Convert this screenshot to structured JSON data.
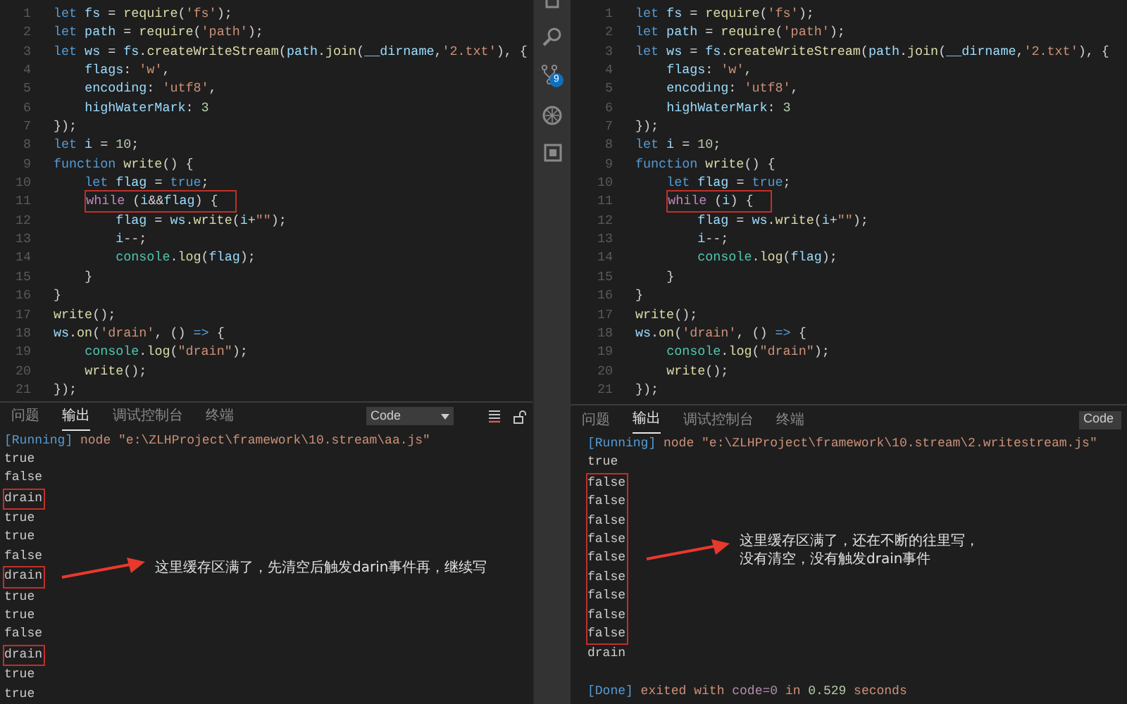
{
  "activity_bar": {
    "badge": "9"
  },
  "panes": [
    {
      "code": [
        {
          "number": "1",
          "boxed": false,
          "tokens": [
            {
              "kind": "kw",
              "text": "let"
            },
            {
              "kind": "var",
              "text": " fs"
            },
            {
              "kind": "plain",
              "text": " = "
            },
            {
              "kind": "fn",
              "text": "require"
            },
            {
              "kind": "plain",
              "text": "("
            },
            {
              "kind": "str",
              "text": "'fs'"
            },
            {
              "kind": "plain",
              "text": ");"
            }
          ]
        },
        {
          "number": "2",
          "boxed": false,
          "tokens": [
            {
              "kind": "kw",
              "text": "let"
            },
            {
              "kind": "var",
              "text": " path"
            },
            {
              "kind": "plain",
              "text": " = "
            },
            {
              "kind": "fn",
              "text": "require"
            },
            {
              "kind": "plain",
              "text": "("
            },
            {
              "kind": "str",
              "text": "'path'"
            },
            {
              "kind": "plain",
              "text": ");"
            }
          ]
        },
        {
          "number": "3",
          "boxed": false,
          "tokens": [
            {
              "kind": "kw",
              "text": "let"
            },
            {
              "kind": "var",
              "text": " ws"
            },
            {
              "kind": "plain",
              "text": " = "
            },
            {
              "kind": "var",
              "text": "fs"
            },
            {
              "kind": "plain",
              "text": "."
            },
            {
              "kind": "fn",
              "text": "createWriteStream"
            },
            {
              "kind": "plain",
              "text": "("
            },
            {
              "kind": "var",
              "text": "path"
            },
            {
              "kind": "plain",
              "text": "."
            },
            {
              "kind": "fn",
              "text": "join"
            },
            {
              "kind": "plain",
              "text": "("
            },
            {
              "kind": "var",
              "text": "__dirname"
            },
            {
              "kind": "plain",
              "text": ","
            },
            {
              "kind": "str",
              "text": "'2.txt'"
            },
            {
              "kind": "plain",
              "text": "), {"
            }
          ]
        },
        {
          "number": "4",
          "boxed": false,
          "tokens": [
            {
              "kind": "var",
              "text": "    flags"
            },
            {
              "kind": "plain",
              "text": ": "
            },
            {
              "kind": "str",
              "text": "'w'"
            },
            {
              "kind": "plain",
              "text": ","
            }
          ]
        },
        {
          "number": "5",
          "boxed": false,
          "tokens": [
            {
              "kind": "var",
              "text": "    encoding"
            },
            {
              "kind": "plain",
              "text": ": "
            },
            {
              "kind": "str",
              "text": "'utf8'"
            },
            {
              "kind": "plain",
              "text": ","
            }
          ]
        },
        {
          "number": "6",
          "boxed": false,
          "tokens": [
            {
              "kind": "var",
              "text": "    highWaterMark"
            },
            {
              "kind": "plain",
              "text": ": "
            },
            {
              "kind": "num",
              "text": "3"
            }
          ]
        },
        {
          "number": "7",
          "boxed": false,
          "tokens": [
            {
              "kind": "plain",
              "text": "});"
            }
          ]
        },
        {
          "number": "8",
          "boxed": false,
          "tokens": [
            {
              "kind": "kw",
              "text": "let"
            },
            {
              "kind": "var",
              "text": " i"
            },
            {
              "kind": "plain",
              "text": " = "
            },
            {
              "kind": "num",
              "text": "10"
            },
            {
              "kind": "plain",
              "text": ";"
            }
          ]
        },
        {
          "number": "9",
          "boxed": false,
          "tokens": [
            {
              "kind": "kw",
              "text": "function"
            },
            {
              "kind": "fn",
              "text": " write"
            },
            {
              "kind": "plain",
              "text": "() {"
            }
          ]
        },
        {
          "number": "10",
          "boxed": false,
          "tokens": [
            {
              "kind": "kw",
              "text": "    let"
            },
            {
              "kind": "var",
              "text": " flag"
            },
            {
              "kind": "plain",
              "text": " = "
            },
            {
              "kind": "kw",
              "text": "true"
            },
            {
              "kind": "plain",
              "text": ";"
            }
          ]
        },
        {
          "number": "11",
          "boxed": true,
          "tokens": [
            {
              "kind": "ctrl",
              "text": "    while"
            },
            {
              "kind": "plain",
              "text": " ("
            },
            {
              "kind": "var",
              "text": "i"
            },
            {
              "kind": "plain",
              "text": "&&"
            },
            {
              "kind": "var",
              "text": "flag"
            },
            {
              "kind": "plain",
              "text": ") {"
            }
          ]
        },
        {
          "number": "12",
          "boxed": false,
          "tokens": [
            {
              "kind": "var",
              "text": "        flag"
            },
            {
              "kind": "plain",
              "text": " = "
            },
            {
              "kind": "var",
              "text": "ws"
            },
            {
              "kind": "plain",
              "text": "."
            },
            {
              "kind": "fn",
              "text": "write"
            },
            {
              "kind": "plain",
              "text": "("
            },
            {
              "kind": "var",
              "text": "i"
            },
            {
              "kind": "plain",
              "text": "+"
            },
            {
              "kind": "str",
              "text": "\"\""
            },
            {
              "kind": "plain",
              "text": ");"
            }
          ]
        },
        {
          "number": "13",
          "boxed": false,
          "tokens": [
            {
              "kind": "var",
              "text": "        i"
            },
            {
              "kind": "plain",
              "text": "--;"
            }
          ]
        },
        {
          "number": "14",
          "boxed": false,
          "tokens": [
            {
              "kind": "type",
              "text": "        console"
            },
            {
              "kind": "plain",
              "text": "."
            },
            {
              "kind": "fn",
              "text": "log"
            },
            {
              "kind": "plain",
              "text": "("
            },
            {
              "kind": "var",
              "text": "flag"
            },
            {
              "kind": "plain",
              "text": ");"
            }
          ]
        },
        {
          "number": "15",
          "boxed": false,
          "tokens": [
            {
              "kind": "plain",
              "text": "    }"
            }
          ]
        },
        {
          "number": "16",
          "boxed": false,
          "tokens": [
            {
              "kind": "plain",
              "text": "}"
            }
          ]
        },
        {
          "number": "17",
          "boxed": false,
          "tokens": [
            {
              "kind": "fn",
              "text": "write"
            },
            {
              "kind": "plain",
              "text": "();"
            }
          ]
        },
        {
          "number": "18",
          "boxed": false,
          "tokens": [
            {
              "kind": "var",
              "text": "ws"
            },
            {
              "kind": "plain",
              "text": "."
            },
            {
              "kind": "fn",
              "text": "on"
            },
            {
              "kind": "plain",
              "text": "("
            },
            {
              "kind": "str",
              "text": "'drain'"
            },
            {
              "kind": "plain",
              "text": ", () "
            },
            {
              "kind": "kw",
              "text": "=>"
            },
            {
              "kind": "plain",
              "text": " {"
            }
          ]
        },
        {
          "number": "19",
          "boxed": false,
          "tokens": [
            {
              "kind": "type",
              "text": "    console"
            },
            {
              "kind": "plain",
              "text": "."
            },
            {
              "kind": "fn",
              "text": "log"
            },
            {
              "kind": "plain",
              "text": "("
            },
            {
              "kind": "str",
              "text": "\"drain\""
            },
            {
              "kind": "plain",
              "text": ");"
            }
          ]
        },
        {
          "number": "20",
          "boxed": false,
          "tokens": [
            {
              "kind": "fn",
              "text": "    write"
            },
            {
              "kind": "plain",
              "text": "();"
            }
          ]
        },
        {
          "number": "21",
          "boxed": false,
          "tokens": [
            {
              "kind": "plain",
              "text": "});"
            }
          ]
        }
      ],
      "panel": {
        "tabs": [
          {
            "label": "问题",
            "selected": false
          },
          {
            "label": "输出",
            "selected": true
          },
          {
            "label": "调试控制台",
            "selected": false
          },
          {
            "label": "终端",
            "selected": false
          }
        ],
        "dropdown": "Code",
        "tools": true
      },
      "output": [
        {
          "kind": "status",
          "tokens": [
            {
              "kind": "tag",
              "text": "[Running]"
            },
            {
              "kind": "msg",
              "text": " node \"e:\\ZLHProject\\framework\\10.stream\\aa.js\""
            }
          ]
        },
        {
          "kind": "plain",
          "text": "true",
          "boxed": false
        },
        {
          "kind": "plain",
          "text": "false",
          "boxed": false
        },
        {
          "kind": "plain",
          "text": "drain",
          "boxed": true
        },
        {
          "kind": "plain",
          "text": "true",
          "boxed": false
        },
        {
          "kind": "plain",
          "text": "true",
          "boxed": false
        },
        {
          "kind": "plain",
          "text": "false",
          "boxed": false
        },
        {
          "kind": "plain",
          "text": "drain",
          "boxed": true
        },
        {
          "kind": "plain",
          "text": "true",
          "boxed": false
        },
        {
          "kind": "plain",
          "text": "true",
          "boxed": false
        },
        {
          "kind": "plain",
          "text": "false",
          "boxed": false
        },
        {
          "kind": "plain",
          "text": "drain",
          "boxed": true
        },
        {
          "kind": "plain",
          "text": "true",
          "boxed": false
        },
        {
          "kind": "plain",
          "text": "true",
          "boxed": false
        }
      ],
      "annotation": {
        "lines": [
          "这里缓存区满了，先清空后触发darin事件再，继续写"
        ]
      }
    },
    {
      "code": [
        {
          "number": "1",
          "boxed": false,
          "tokens": [
            {
              "kind": "kw",
              "text": "let"
            },
            {
              "kind": "var",
              "text": " fs"
            },
            {
              "kind": "plain",
              "text": " = "
            },
            {
              "kind": "fn",
              "text": "require"
            },
            {
              "kind": "plain",
              "text": "("
            },
            {
              "kind": "str",
              "text": "'fs'"
            },
            {
              "kind": "plain",
              "text": ");"
            }
          ]
        },
        {
          "number": "2",
          "boxed": false,
          "tokens": [
            {
              "kind": "kw",
              "text": "let"
            },
            {
              "kind": "var",
              "text": " path"
            },
            {
              "kind": "plain",
              "text": " = "
            },
            {
              "kind": "fn",
              "text": "require"
            },
            {
              "kind": "plain",
              "text": "("
            },
            {
              "kind": "str",
              "text": "'path'"
            },
            {
              "kind": "plain",
              "text": ");"
            }
          ]
        },
        {
          "number": "3",
          "boxed": false,
          "tokens": [
            {
              "kind": "kw",
              "text": "let"
            },
            {
              "kind": "var",
              "text": " ws"
            },
            {
              "kind": "plain",
              "text": " = "
            },
            {
              "kind": "var",
              "text": "fs"
            },
            {
              "kind": "plain",
              "text": "."
            },
            {
              "kind": "fn",
              "text": "createWriteStream"
            },
            {
              "kind": "plain",
              "text": "("
            },
            {
              "kind": "var",
              "text": "path"
            },
            {
              "kind": "plain",
              "text": "."
            },
            {
              "kind": "fn",
              "text": "join"
            },
            {
              "kind": "plain",
              "text": "("
            },
            {
              "kind": "var",
              "text": "__dirname"
            },
            {
              "kind": "plain",
              "text": ","
            },
            {
              "kind": "str",
              "text": "'2.txt'"
            },
            {
              "kind": "plain",
              "text": "), {"
            }
          ]
        },
        {
          "number": "4",
          "boxed": false,
          "tokens": [
            {
              "kind": "var",
              "text": "    flags"
            },
            {
              "kind": "plain",
              "text": ": "
            },
            {
              "kind": "str",
              "text": "'w'"
            },
            {
              "kind": "plain",
              "text": ","
            }
          ]
        },
        {
          "number": "5",
          "boxed": false,
          "tokens": [
            {
              "kind": "var",
              "text": "    encoding"
            },
            {
              "kind": "plain",
              "text": ": "
            },
            {
              "kind": "str",
              "text": "'utf8'"
            },
            {
              "kind": "plain",
              "text": ","
            }
          ]
        },
        {
          "number": "6",
          "boxed": false,
          "tokens": [
            {
              "kind": "var",
              "text": "    highWaterMark"
            },
            {
              "kind": "plain",
              "text": ": "
            },
            {
              "kind": "num",
              "text": "3"
            }
          ]
        },
        {
          "number": "7",
          "boxed": false,
          "tokens": [
            {
              "kind": "plain",
              "text": "});"
            }
          ]
        },
        {
          "number": "8",
          "boxed": false,
          "tokens": [
            {
              "kind": "kw",
              "text": "let"
            },
            {
              "kind": "var",
              "text": " i"
            },
            {
              "kind": "plain",
              "text": " = "
            },
            {
              "kind": "num",
              "text": "10"
            },
            {
              "kind": "plain",
              "text": ";"
            }
          ]
        },
        {
          "number": "9",
          "boxed": false,
          "tokens": [
            {
              "kind": "kw",
              "text": "function"
            },
            {
              "kind": "fn",
              "text": " write"
            },
            {
              "kind": "plain",
              "text": "() {"
            }
          ]
        },
        {
          "number": "10",
          "boxed": false,
          "tokens": [
            {
              "kind": "kw",
              "text": "    let"
            },
            {
              "kind": "var",
              "text": " flag"
            },
            {
              "kind": "plain",
              "text": " = "
            },
            {
              "kind": "kw",
              "text": "true"
            },
            {
              "kind": "plain",
              "text": ";"
            }
          ]
        },
        {
          "number": "11",
          "boxed": true,
          "tokens": [
            {
              "kind": "ctrl",
              "text": "    while"
            },
            {
              "kind": "plain",
              "text": " ("
            },
            {
              "kind": "var",
              "text": "i"
            },
            {
              "kind": "plain",
              "text": ") {"
            }
          ]
        },
        {
          "number": "12",
          "boxed": false,
          "tokens": [
            {
              "kind": "var",
              "text": "        flag"
            },
            {
              "kind": "plain",
              "text": " = "
            },
            {
              "kind": "var",
              "text": "ws"
            },
            {
              "kind": "plain",
              "text": "."
            },
            {
              "kind": "fn",
              "text": "write"
            },
            {
              "kind": "plain",
              "text": "("
            },
            {
              "kind": "var",
              "text": "i"
            },
            {
              "kind": "plain",
              "text": "+"
            },
            {
              "kind": "str",
              "text": "\"\""
            },
            {
              "kind": "plain",
              "text": ");"
            }
          ]
        },
        {
          "number": "13",
          "boxed": false,
          "tokens": [
            {
              "kind": "var",
              "text": "        i"
            },
            {
              "kind": "plain",
              "text": "--;"
            }
          ]
        },
        {
          "number": "14",
          "boxed": false,
          "tokens": [
            {
              "kind": "type",
              "text": "        console"
            },
            {
              "kind": "plain",
              "text": "."
            },
            {
              "kind": "fn",
              "text": "log"
            },
            {
              "kind": "plain",
              "text": "("
            },
            {
              "kind": "var",
              "text": "flag"
            },
            {
              "kind": "plain",
              "text": ");"
            }
          ]
        },
        {
          "number": "15",
          "boxed": false,
          "tokens": [
            {
              "kind": "plain",
              "text": "    }"
            }
          ]
        },
        {
          "number": "16",
          "boxed": false,
          "tokens": [
            {
              "kind": "plain",
              "text": "}"
            }
          ]
        },
        {
          "number": "17",
          "boxed": false,
          "tokens": [
            {
              "kind": "fn",
              "text": "write"
            },
            {
              "kind": "plain",
              "text": "();"
            }
          ]
        },
        {
          "number": "18",
          "boxed": false,
          "tokens": [
            {
              "kind": "var",
              "text": "ws"
            },
            {
              "kind": "plain",
              "text": "."
            },
            {
              "kind": "fn",
              "text": "on"
            },
            {
              "kind": "plain",
              "text": "("
            },
            {
              "kind": "str",
              "text": "'drain'"
            },
            {
              "kind": "plain",
              "text": ", () "
            },
            {
              "kind": "kw",
              "text": "=>"
            },
            {
              "kind": "plain",
              "text": " {"
            }
          ]
        },
        {
          "number": "19",
          "boxed": false,
          "tokens": [
            {
              "kind": "type",
              "text": "    console"
            },
            {
              "kind": "plain",
              "text": "."
            },
            {
              "kind": "fn",
              "text": "log"
            },
            {
              "kind": "plain",
              "text": "("
            },
            {
              "kind": "str",
              "text": "\"drain\""
            },
            {
              "kind": "plain",
              "text": ");"
            }
          ]
        },
        {
          "number": "20",
          "boxed": false,
          "tokens": [
            {
              "kind": "fn",
              "text": "    write"
            },
            {
              "kind": "plain",
              "text": "();"
            }
          ]
        },
        {
          "number": "21",
          "boxed": false,
          "tokens": [
            {
              "kind": "plain",
              "text": "});"
            }
          ]
        }
      ],
      "panel": {
        "tabs": [
          {
            "label": "问题",
            "selected": false
          },
          {
            "label": "输出",
            "selected": true
          },
          {
            "label": "调试控制台",
            "selected": false
          },
          {
            "label": "终端",
            "selected": false
          }
        ],
        "dropdown": "Code",
        "tools": false
      },
      "output": [
        {
          "kind": "status",
          "tokens": [
            {
              "kind": "tag",
              "text": "[Running]"
            },
            {
              "kind": "msg",
              "text": " node \"e:\\ZLHProject\\framework\\10.stream\\2.writestream.js\""
            }
          ]
        },
        {
          "kind": "plain",
          "text": "true",
          "boxed": false
        },
        {
          "kind": "plain",
          "text": "false",
          "boxed": true
        },
        {
          "kind": "plain",
          "text": "false",
          "boxed": true
        },
        {
          "kind": "plain",
          "text": "false",
          "boxed": true
        },
        {
          "kind": "plain",
          "text": "false",
          "boxed": true
        },
        {
          "kind": "plain",
          "text": "false",
          "boxed": true
        },
        {
          "kind": "plain",
          "text": "false",
          "boxed": true
        },
        {
          "kind": "plain",
          "text": "false",
          "boxed": true
        },
        {
          "kind": "plain",
          "text": "false",
          "boxed": true
        },
        {
          "kind": "plain",
          "text": "false",
          "boxed": true
        },
        {
          "kind": "plain",
          "text": "drain",
          "boxed": false
        },
        {
          "kind": "blank"
        },
        {
          "kind": "status",
          "tokens": [
            {
              "kind": "tag",
              "text": "[Done]"
            },
            {
              "kind": "msg",
              "text": " exited with "
            },
            {
              "kind": "code",
              "text": "code=0"
            },
            {
              "kind": "msg",
              "text": " in "
            },
            {
              "kind": "time",
              "text": "0.529"
            },
            {
              "kind": "msg",
              "text": " seconds"
            }
          ]
        }
      ],
      "annotation": {
        "lines": [
          "这里缓存区满了，还在不断的往里写，",
          "没有清空，没有触发drain事件"
        ]
      }
    }
  ]
}
